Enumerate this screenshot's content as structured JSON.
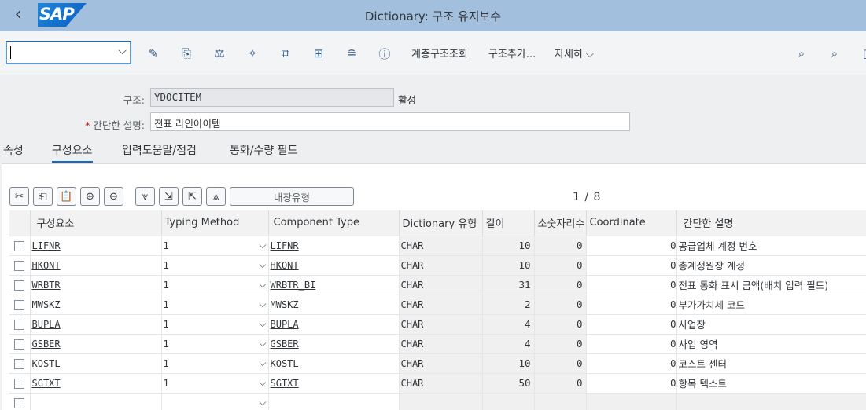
{
  "header": {
    "title": "Dictionary: 구조 유지보수",
    "logo": "SAP",
    "back_icon": "back-icon"
  },
  "toolbar": {
    "command_value": "",
    "icons": [
      "pencil-glasses-icon",
      "activate-icon",
      "check-balance-icon",
      "magic-wand-icon",
      "where-used-icon",
      "hierarchy-icon",
      "stack-icon",
      "info-icon"
    ],
    "links": [
      "계층구조조회",
      "구조추가...",
      "자세히"
    ],
    "right_icons": [
      "search-icon",
      "search-plus-icon"
    ]
  },
  "form": {
    "structure_label": "구조:",
    "structure_value": "YDOCITEM",
    "status": "활성",
    "required_mark": "*",
    "short_desc_label": "간단한 설명:",
    "short_desc_value": "전표 라인아이템"
  },
  "tabs": [
    "속성",
    "구성요소",
    "입력도움말/점검",
    "통화/수량 필드"
  ],
  "active_tab": "구성요소",
  "table_toolbar": {
    "buttons": [
      "cut-icon",
      "copy-icon",
      "paste-icon",
      "plus-icon",
      "minus-icon",
      "expand-all-icon",
      "insert-row-icon",
      "delete-row-icon",
      "collapse-icon"
    ],
    "builtin_type_label": "내장유형"
  },
  "pager": {
    "current": "1",
    "sep": "/",
    "total": "8"
  },
  "columns": [
    "구성요소",
    "Typing Method",
    "Component Type",
    "Dictionary 유형",
    "길이",
    "소숫자리수",
    "Coordinate",
    "간단한 설명"
  ],
  "rows": [
    {
      "component": "LIFNR",
      "typing": "1",
      "comp_type": "LIFNR",
      "dict_type": "CHAR",
      "length": "10",
      "decimals": "0",
      "coordinate": "0",
      "desc": "공급업체 계정 번호"
    },
    {
      "component": "HKONT",
      "typing": "1",
      "comp_type": "HKONT",
      "dict_type": "CHAR",
      "length": "10",
      "decimals": "0",
      "coordinate": "0",
      "desc": "총계정원장 계정"
    },
    {
      "component": "WRBTR",
      "typing": "1",
      "comp_type": "WRBTR_BI",
      "dict_type": "CHAR",
      "length": "31",
      "decimals": "0",
      "coordinate": "0",
      "desc": "전표 통화 표시 금액(배치 입력 필드)"
    },
    {
      "component": "MWSKZ",
      "typing": "1",
      "comp_type": "MWSKZ",
      "dict_type": "CHAR",
      "length": "2",
      "decimals": "0",
      "coordinate": "0",
      "desc": "부가가치세 코드"
    },
    {
      "component": "BUPLA",
      "typing": "1",
      "comp_type": "BUPLA",
      "dict_type": "CHAR",
      "length": "4",
      "decimals": "0",
      "coordinate": "0",
      "desc": "사업장"
    },
    {
      "component": "GSBER",
      "typing": "1",
      "comp_type": "GSBER",
      "dict_type": "CHAR",
      "length": "4",
      "decimals": "0",
      "coordinate": "0",
      "desc": "사업 영역"
    },
    {
      "component": "KOSTL",
      "typing": "1",
      "comp_type": "KOSTL",
      "dict_type": "CHAR",
      "length": "10",
      "decimals": "0",
      "coordinate": "0",
      "desc": "코스트 센터"
    },
    {
      "component": "SGTXT",
      "typing": "1",
      "comp_type": "SGTXT",
      "dict_type": "CHAR",
      "length": "50",
      "decimals": "0",
      "coordinate": "0",
      "desc": "항목 텍스트"
    },
    {
      "component": "",
      "typing": "",
      "comp_type": "",
      "dict_type": "",
      "length": "",
      "decimals": "",
      "coordinate": "",
      "desc": ""
    }
  ]
}
